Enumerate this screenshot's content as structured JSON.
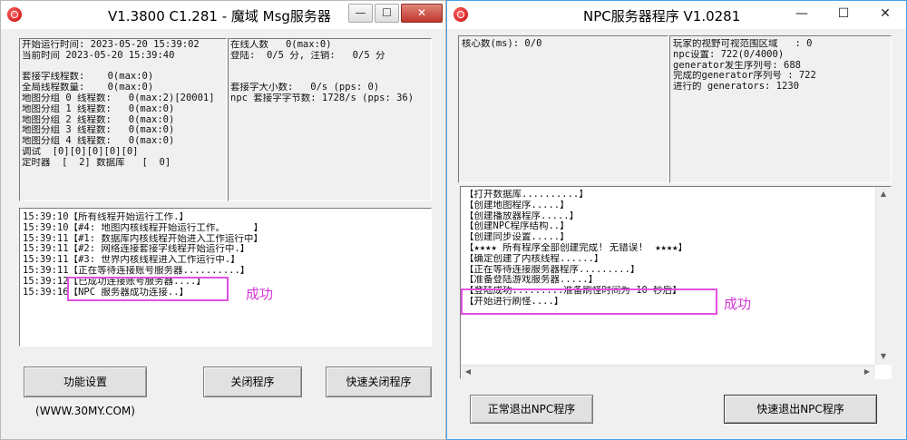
{
  "win1": {
    "title": "V1.3800 C1.281  - 魔域  Msg服务器",
    "stats_left": [
      "开始运行时间: 2023-05-20 15:39:02",
      "当前时间 2023-05-20 15:39:40",
      "",
      "套接字线程数:    0(max:0)",
      "全局线程数量:    0(max:0)",
      "地图分组 0 线程数:   0(max:2)[20001]",
      "地图分组 1 线程数:   0(max:0)",
      "地图分组 2 线程数:   0(max:0)",
      "地图分组 3 线程数:   0(max:0)",
      "地图分组 4 线程数:   0(max:0)",
      "调试  [0][0][0][0][0]",
      "定时器  [  2] 数据库   [  0]"
    ],
    "stats_right": [
      "在线人数   0(max:0)",
      "登陆:  0/5 分, 注销:   0/5 分",
      "",
      "",
      "套接字大小数:   0/s (pps: 0)",
      "npc 套接字字节数: 1728/s (pps: 36)"
    ],
    "log": [
      "15:39:10【所有线程开始运行工作.】",
      "15:39:10【#4: 地图内核线程开始运行工作。     】",
      "15:39:11【#1: 数据库内核线程开始进入工作运行中】",
      "15:39:11【#2: 网络连接套接字线程开始运行中.】",
      "15:39:11【#3: 世界内核线程进入工作运行中.】",
      "15:39:11【正在等待连接账号服务器..........】",
      "15:39:12【已成功连接账号服务器....】",
      "15:39:16【NPC 服务器成功连接..】"
    ],
    "success_label": "成功",
    "buttons": {
      "settings": "功能设置(WWW.30MY.COM)",
      "close": "关闭程序",
      "quick_close": "快速关闭程序"
    }
  },
  "win2": {
    "title": "NPC服务器程序       V1.0281",
    "stats_left": [
      "核心数(ms): 0/0"
    ],
    "stats_right": [
      "玩家的视野可视范围区域   : 0",
      "npc设置: 722(0/4000)",
      "generator发生序列号: 688",
      "完成的generator序列号 : 722",
      "进行的 generators: 1230"
    ],
    "log": [
      "【打开数据库..........】",
      "【创建地图程序.....】",
      "【创建播放器程序.....】",
      "【创建NPC程序结构..】",
      "【创建同步设置.....】",
      "【★★★★ 所有程序全部创建完成! 无错误!  ★★★★】",
      "【确定创建了内核线程......】",
      "【正在等待连接服务器程序.........】",
      "【准备登陆游戏服务器.....】",
      "【登陆成功.........准备刷怪时间为 10 秒后】",
      "【开始进行刷怪....】"
    ],
    "success_label": "成功",
    "buttons": {
      "normal_exit": "正常退出NPC程序",
      "quick_exit": "快速退出NPC程序"
    }
  },
  "controls": {
    "minimize": "—",
    "maximize": "☐",
    "close": "✕"
  }
}
